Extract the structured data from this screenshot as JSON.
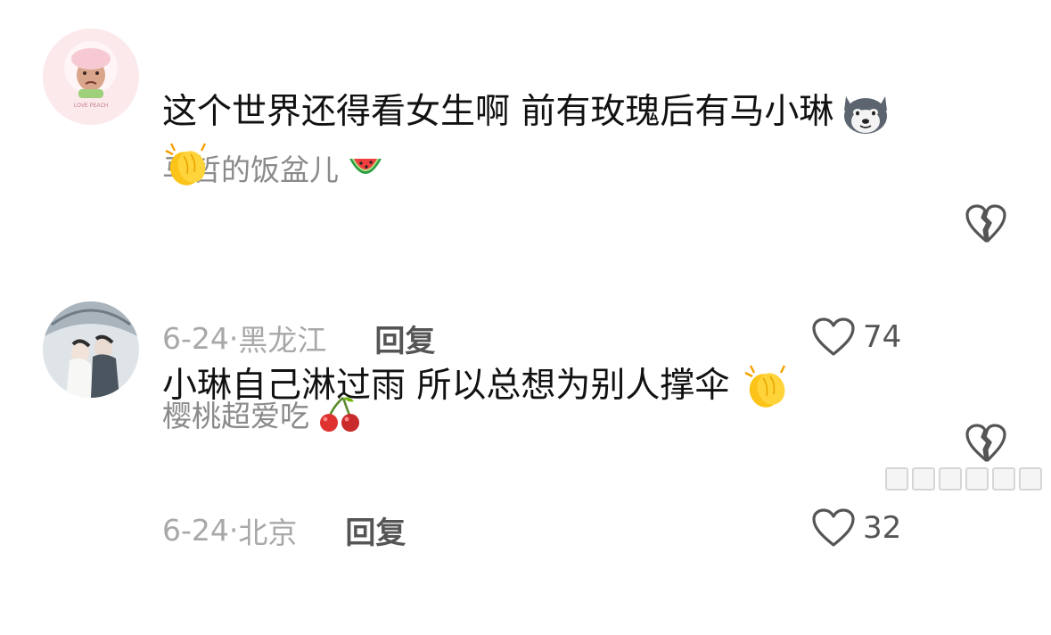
{
  "comments": [
    {
      "username": "马哲的饭盆儿",
      "username_emoji": "watermelon-icon",
      "text_line1": "这个世界还得看女生啊 前有玫瑰后有马小琳",
      "text_line1_emoji": "husky-dog-icon",
      "text_line2_emoji": "clapping-hands-icon",
      "avatar_label": "LOVE PEACH",
      "date": "6-24",
      "location": "黑龙江",
      "separator": "·",
      "reply_label": "回复",
      "likes": "74"
    },
    {
      "username": "樱桃超爱吃",
      "username_emoji": "cherries-icon",
      "text_line1": "小琳自己淋过雨 所以总想为别人撑伞",
      "text_line1_emoji": "clapping-hands-icon",
      "date": "6-24",
      "location": "北京",
      "separator": "·",
      "reply_label": "回复",
      "likes": "32"
    }
  ],
  "colors": {
    "username": "#8a8a8a",
    "text": "#111111",
    "meta": "#a8a8a8",
    "action": "#555555",
    "background": "#ffffff"
  }
}
